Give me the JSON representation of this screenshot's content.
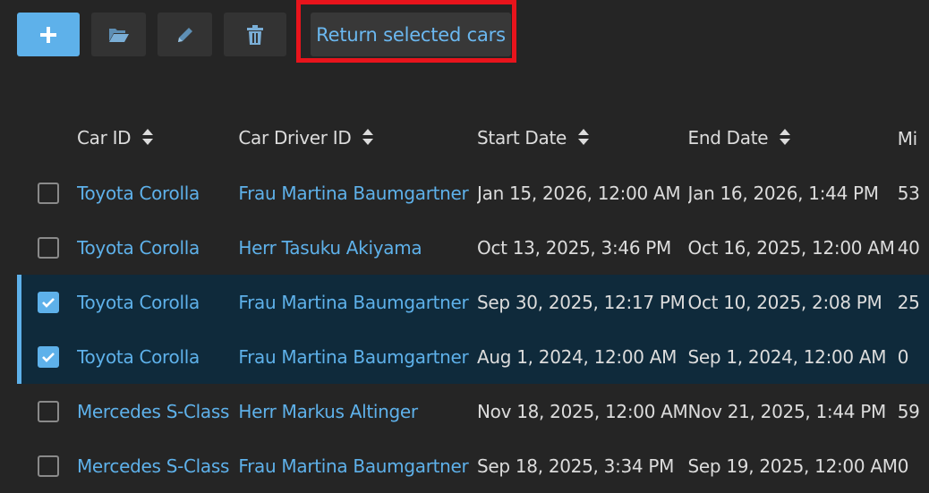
{
  "toolbar": {
    "add_icon": "plus-icon",
    "open_icon": "folder-open-icon",
    "edit_icon": "pencil-icon",
    "delete_icon": "trash-icon",
    "return_label": "Return selected cars"
  },
  "colors": {
    "accent": "#5eb1ea",
    "highlight": "#e8141c",
    "selected_row": "#0f2a3b",
    "background": "#252525"
  },
  "table": {
    "columns": [
      "Car ID",
      "Car Driver ID",
      "Start Date",
      "End Date",
      "Mi"
    ],
    "rows": [
      {
        "checked": false,
        "car": "Toyota Corolla",
        "driver": "Frau Martina Baumgartner",
        "start": "Jan 15, 2026, 12:00 AM",
        "end": "Jan 16, 2026, 1:44 PM",
        "mi": "53"
      },
      {
        "checked": false,
        "car": "Toyota Corolla",
        "driver": "Herr Tasuku Akiyama",
        "start": "Oct 13, 2025, 3:46 PM",
        "end": "Oct 16, 2025, 12:00 AM",
        "mi": "40"
      },
      {
        "checked": true,
        "car": "Toyota Corolla",
        "driver": "Frau Martina Baumgartner",
        "start": "Sep 30, 2025, 12:17 PM",
        "end": "Oct 10, 2025, 2:08 PM",
        "mi": "25"
      },
      {
        "checked": true,
        "car": "Toyota Corolla",
        "driver": "Frau Martina Baumgartner",
        "start": "Aug 1, 2024, 12:00 AM",
        "end": "Sep 1, 2024, 12:00 AM",
        "mi": "0"
      },
      {
        "checked": false,
        "car": "Mercedes S-Class",
        "driver": "Herr Markus Altinger",
        "start": "Nov 18, 2025, 12:00 AM",
        "end": "Nov 21, 2025, 1:44 PM",
        "mi": "59"
      },
      {
        "checked": false,
        "car": "Mercedes S-Class",
        "driver": "Frau Martina Baumgartner",
        "start": "Sep 18, 2025, 3:34 PM",
        "end": "Sep 19, 2025, 12:00 AM",
        "mi": "0"
      }
    ]
  }
}
